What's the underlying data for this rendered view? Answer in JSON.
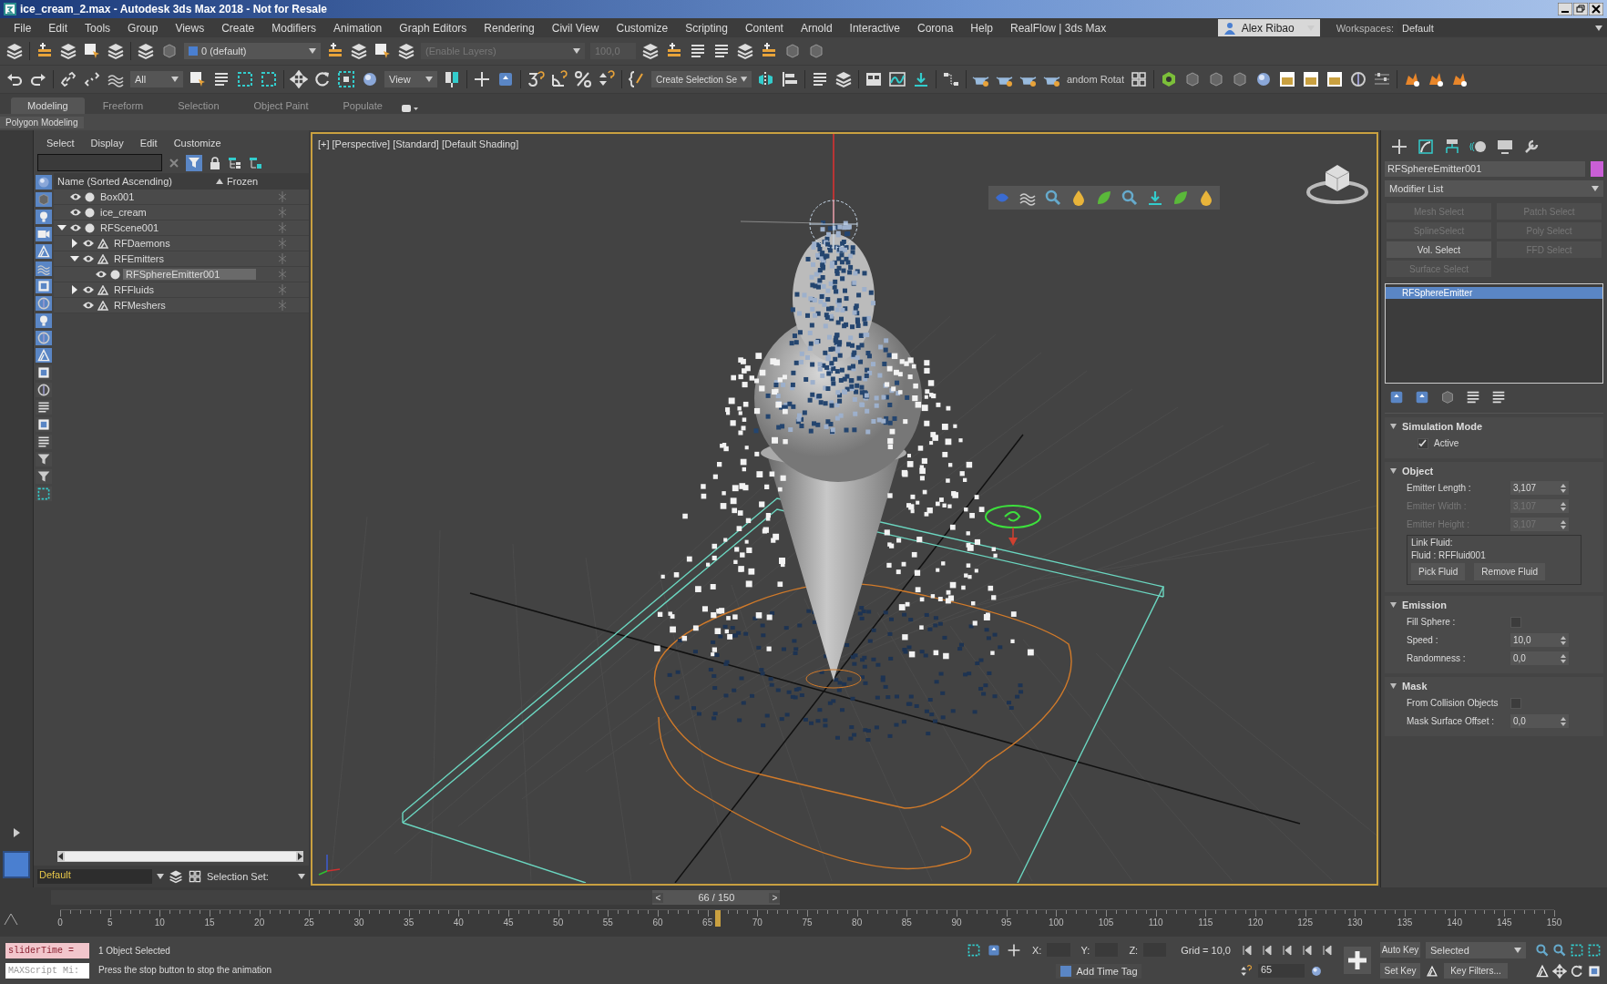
{
  "window": {
    "title": "ice_cream_2.max - Autodesk 3ds Max 2018 - Not for Resale"
  },
  "menu": [
    "File",
    "Edit",
    "Tools",
    "Group",
    "Views",
    "Create",
    "Modifiers",
    "Animation",
    "Graph Editors",
    "Rendering",
    "Civil View",
    "Customize",
    "Scripting",
    "Content",
    "Arnold",
    "Interactive",
    "Corona",
    "Help",
    "RealFlow | 3ds Max"
  ],
  "user": {
    "name": "Alex Ribao"
  },
  "workspaces": {
    "label": "Workspaces:",
    "value": "Default"
  },
  "toolbar_main": {
    "layer": "0 (default)",
    "layer_placeholder": "(Enable Layers)",
    "layer_value": "100,0"
  },
  "toolbar_transform": {
    "filter": "All",
    "coordinate_system": "View",
    "selection_set": "Create Selection Se",
    "random_rotate": "andom Rotat"
  },
  "ribbon": {
    "tabs": [
      {
        "label": "Modeling",
        "selected": true
      },
      {
        "label": "Freeform",
        "selected": false
      },
      {
        "label": "Selection",
        "selected": false
      },
      {
        "label": "Object Paint",
        "selected": false
      },
      {
        "label": "Populate",
        "selected": false
      }
    ],
    "panel": "Polygon Modeling"
  },
  "explorer": {
    "menu": [
      "Select",
      "Display",
      "Edit",
      "Customize"
    ],
    "columns": [
      "Name (Sorted Ascending)",
      "Frozen"
    ],
    "tree": [
      {
        "label": "Box001",
        "kind": "object",
        "selected": false
      },
      {
        "label": "ice_cream",
        "kind": "object",
        "selected": false
      },
      {
        "label": "RFScene001",
        "kind": "object",
        "selected": false,
        "expanded": true,
        "children": [
          {
            "label": "RFDaemons",
            "kind": "helper",
            "selected": false,
            "expanded": false
          },
          {
            "label": "RFEmitters",
            "kind": "helper",
            "selected": false,
            "expanded": true,
            "children": [
              {
                "label": "RFSphereEmitter001",
                "kind": "object",
                "selected": true
              }
            ]
          },
          {
            "label": "RFFluids",
            "kind": "helper",
            "selected": false,
            "expanded": false
          },
          {
            "label": "RFMeshers",
            "kind": "helper",
            "selected": false
          }
        ]
      }
    ],
    "layer_field": "Default",
    "selection_set_label": "Selection Set:"
  },
  "viewport": {
    "labels": [
      "[+]",
      "[Perspective]",
      "[Standard]",
      "[Default Shading]"
    ]
  },
  "command_panel": {
    "object_name": "RFSphereEmitter001",
    "modifier_list": "Modifier List",
    "modifier_buttons": [
      {
        "label": "Mesh Select",
        "disabled": true
      },
      {
        "label": "Patch Select",
        "disabled": true
      },
      {
        "label": "SplineSelect",
        "disabled": true
      },
      {
        "label": "Poly Select",
        "disabled": true
      },
      {
        "label": "Vol. Select",
        "disabled": false
      },
      {
        "label": "FFD Select",
        "disabled": true
      },
      {
        "label": "Surface Select",
        "disabled": true
      }
    ],
    "stack": [
      {
        "label": "RFSphereEmitter",
        "selected": true
      }
    ],
    "rollouts": [
      {
        "title": "Simulation Mode",
        "expanded": true,
        "rows": [
          {
            "kind": "checkbox",
            "label": "Active",
            "checked": true
          }
        ]
      },
      {
        "title": "Object",
        "expanded": true,
        "rows": [
          {
            "kind": "spinner",
            "label": "Emitter Length :",
            "value": "3,107",
            "disabled": false
          },
          {
            "kind": "spinner",
            "label": "Emitter Width :",
            "value": "3,107",
            "disabled": true
          },
          {
            "kind": "spinner",
            "label": "Emitter Height :",
            "value": "3,107",
            "disabled": true
          },
          {
            "kind": "link",
            "title": "Link Fluid:",
            "text": "Fluid : RFFluid001",
            "buttons": [
              "Pick Fluid",
              "Remove Fluid"
            ]
          }
        ]
      },
      {
        "title": "Emission",
        "expanded": true,
        "rows": [
          {
            "kind": "toggle",
            "label": "Fill Sphere :",
            "checked": false
          },
          {
            "kind": "spinner",
            "label": "Speed :",
            "value": "10,0",
            "disabled": false
          },
          {
            "kind": "spinner",
            "label": "Randomness :",
            "value": "0,0",
            "disabled": false
          }
        ]
      },
      {
        "title": "Mask",
        "expanded": true,
        "rows": [
          {
            "kind": "toggle",
            "label": "From Collision Objects",
            "checked": false
          },
          {
            "kind": "spinner",
            "label": "Mask Surface Offset :",
            "value": "0,0",
            "disabled": false
          }
        ]
      }
    ]
  },
  "timeline": {
    "frame": "66 / 150",
    "prev": "<",
    "next": ">",
    "level": 0.44,
    "ticks": [
      "0",
      "5",
      "10",
      "15",
      "20",
      "25",
      "30",
      "35",
      "40",
      "45",
      "50",
      "55",
      "60",
      "65",
      "70",
      "75",
      "80",
      "85",
      "90",
      "95",
      "100",
      "105",
      "110",
      "115",
      "120",
      "125",
      "130",
      "135",
      "140",
      "145",
      "150"
    ]
  },
  "status": {
    "script_field": "sliderTime =",
    "listener": "MAXScript Mi:",
    "selection": "1 Object Selected",
    "prompt": "Press the stop button to stop the animation",
    "coords": [
      "X:",
      "Y:",
      "Z:"
    ],
    "grid": "Grid = 10,0",
    "add_time_tag": "Add Time Tag",
    "auto_key": "Auto Key",
    "key_mode": "Selected",
    "set_key": "Set Key",
    "key_filters": "Key Filters...",
    "frame": "65"
  }
}
